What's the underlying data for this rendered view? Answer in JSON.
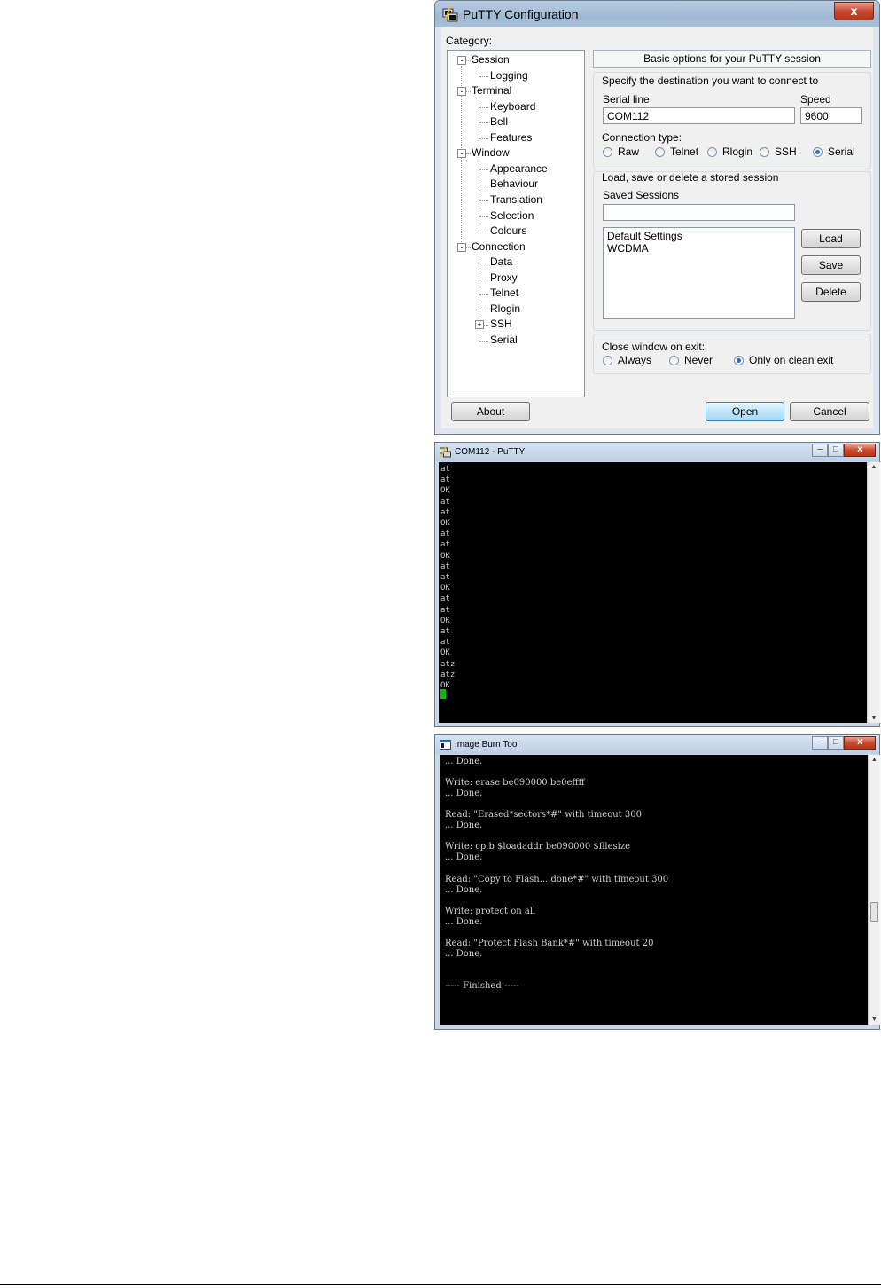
{
  "putty_config": {
    "title": "PuTTY Configuration",
    "close_label": "x",
    "category_label": "Category:",
    "tree": [
      {
        "label": "Session",
        "expander": "-"
      },
      {
        "label": "Logging"
      },
      {
        "label": "Terminal",
        "expander": "-"
      },
      {
        "label": "Keyboard"
      },
      {
        "label": "Bell"
      },
      {
        "label": "Features"
      },
      {
        "label": "Window",
        "expander": "-"
      },
      {
        "label": "Appearance"
      },
      {
        "label": "Behaviour"
      },
      {
        "label": "Translation"
      },
      {
        "label": "Selection"
      },
      {
        "label": "Colours"
      },
      {
        "label": "Connection",
        "expander": "-"
      },
      {
        "label": "Data"
      },
      {
        "label": "Proxy"
      },
      {
        "label": "Telnet"
      },
      {
        "label": "Rlogin"
      },
      {
        "label": "SSH",
        "expander": "+"
      },
      {
        "label": "Serial"
      }
    ],
    "header": "Basic options for your PuTTY session",
    "destination_label": "Specify the destination you want to connect to",
    "serial_line_label": "Serial line",
    "serial_line_value": "COM112",
    "speed_label": "Speed",
    "speed_value": "9600",
    "connection_type_label": "Connection type:",
    "connection_types": [
      {
        "label": "Raw",
        "selected": false
      },
      {
        "label": "Telnet",
        "selected": false
      },
      {
        "label": "Rlogin",
        "selected": false
      },
      {
        "label": "SSH",
        "selected": false
      },
      {
        "label": "Serial",
        "selected": true
      }
    ],
    "stored_session_label": "Load, save or delete a stored session",
    "saved_sessions_label": "Saved Sessions",
    "saved_sessions_value": "",
    "sessions": [
      "Default Settings",
      "WCDMA"
    ],
    "load_label": "Load",
    "save_label": "Save",
    "delete_label": "Delete",
    "close_window_label": "Close window on exit:",
    "close_options": [
      {
        "label": "Always",
        "selected": false
      },
      {
        "label": "Never",
        "selected": false
      },
      {
        "label": "Only on clean exit",
        "selected": true
      }
    ],
    "about_label": "About",
    "open_label": "Open",
    "cancel_label": "Cancel"
  },
  "putty_terminal": {
    "title": "COM112 - PuTTY",
    "output": "at\nat\nOK\nat\nat\nOK\nat\nat\nOK\nat\nat\nOK\nat\nat\nOK\nat\nat\nOK\natz\natz\nOK",
    "cursor_color": "#00c000"
  },
  "burn_tool": {
    "title": "Image Burn Tool",
    "output": "... Done.\n\nWrite: erase be090000 be0effff\n... Done.\n\nRead: \"Erased*sectors*#\" with timeout 300\n... Done.\n\nWrite: cp.b $loadaddr be090000 $filesize\n... Done.\n\nRead: \"Copy to Flash... done*#\" with timeout 300\n... Done.\n\nWrite: protect on all\n... Done.\n\nRead: \"Protect Flash Bank*#\" with timeout 20\n... Done.\n\n\n----- Finished -----"
  }
}
